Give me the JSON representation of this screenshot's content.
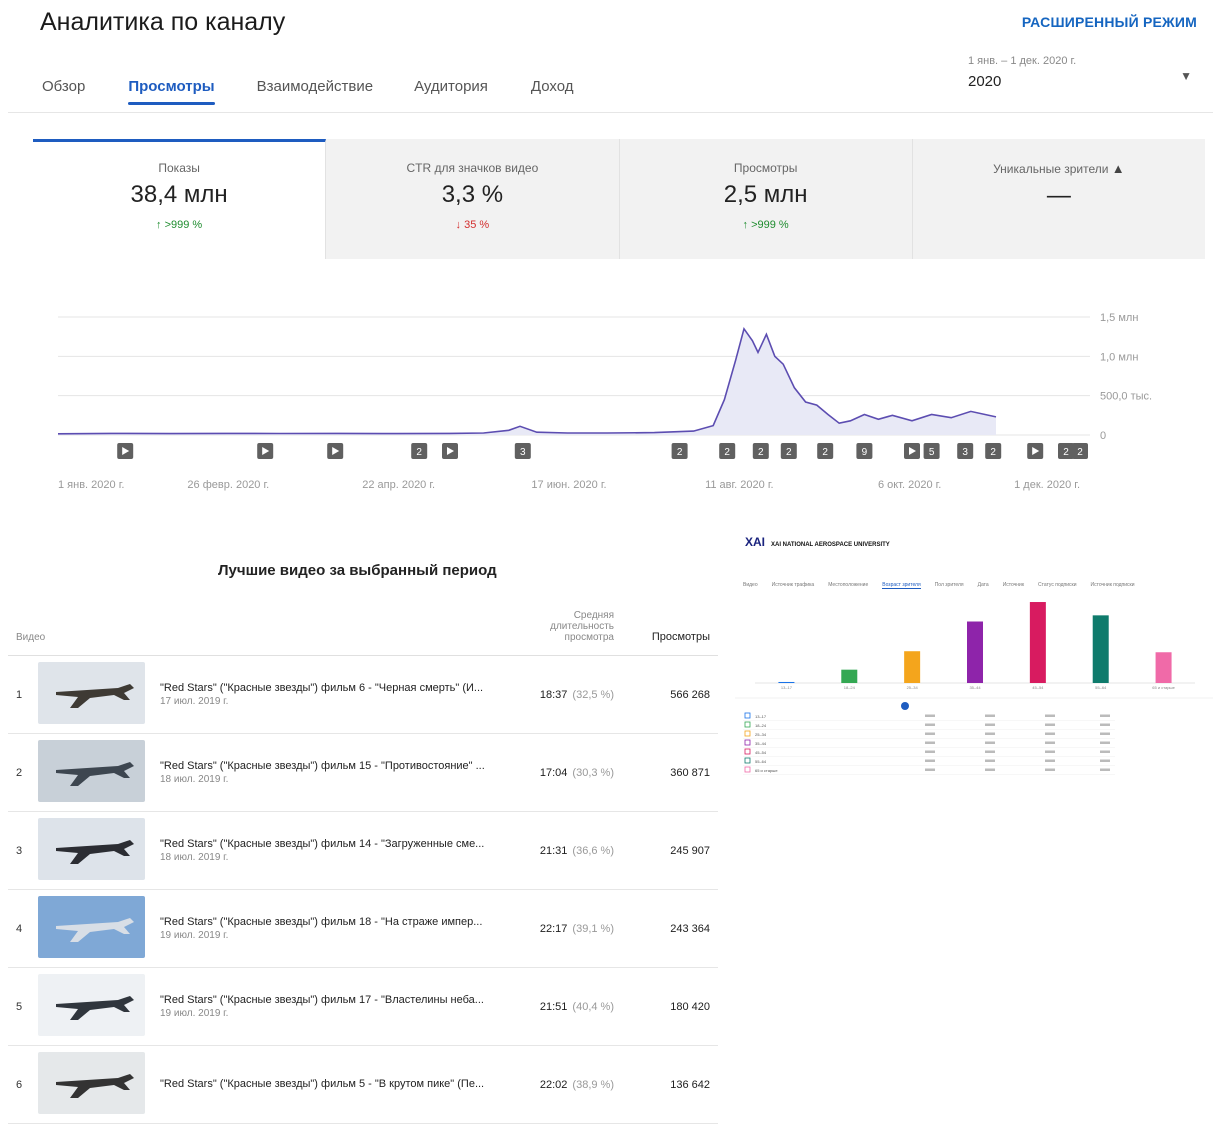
{
  "header": {
    "title": "Аналитика по каналу",
    "advanced_mode": "РАСШИРЕННЫЙ РЕЖИМ"
  },
  "tabs": [
    {
      "label": "Обзор",
      "active": false
    },
    {
      "label": "Просмотры",
      "active": true
    },
    {
      "label": "Взаимодействие",
      "active": false
    },
    {
      "label": "Аудитория",
      "active": false
    },
    {
      "label": "Доход",
      "active": false
    }
  ],
  "period": {
    "range": "1 янв. – 1 дек. 2020 г.",
    "year": "2020"
  },
  "metrics": [
    {
      "label": "Показы",
      "value": "38,4 млн",
      "change": ">999 %",
      "direction": "up",
      "arrow": "↑"
    },
    {
      "label": "CTR для значков видео",
      "value": "3,3 %",
      "change": "35 %",
      "direction": "down",
      "arrow": "↓"
    },
    {
      "label": "Просмотры",
      "value": "2,5 млн",
      "change": ">999 %",
      "direction": "up",
      "arrow": "↑"
    },
    {
      "label": "Уникальные зрители",
      "value": "—",
      "change": "",
      "direction": "none",
      "warning_icon": "warning-icon"
    }
  ],
  "chart_data": {
    "type": "area",
    "x_ticks": [
      "1 янв. 2020 г.",
      "26 февр. 2020 г.",
      "22 апр. 2020 г.",
      "17 июн. 2020 г.",
      "11 авг. 2020 г.",
      "6 окт. 2020 г.",
      "1 дек. 2020 г."
    ],
    "y_ticks": [
      "1,5 млн",
      "1,0 млн",
      "500,0 тыс.",
      "0"
    ],
    "ylim": [
      0,
      1500000
    ],
    "color": "#5c4db1",
    "x": [
      "2020-01-01",
      "2020-01-20",
      "2020-02-10",
      "2020-03-01",
      "2020-03-20",
      "2020-04-10",
      "2020-05-01",
      "2020-05-20",
      "2020-06-01",
      "2020-06-10",
      "2020-06-14",
      "2020-06-20",
      "2020-07-01",
      "2020-07-15",
      "2020-08-01",
      "2020-08-15",
      "2020-08-22",
      "2020-08-26",
      "2020-08-30",
      "2020-09-02",
      "2020-09-05",
      "2020-09-07",
      "2020-09-10",
      "2020-09-13",
      "2020-09-16",
      "2020-09-20",
      "2020-09-24",
      "2020-09-28",
      "2020-10-02",
      "2020-10-06",
      "2020-10-10",
      "2020-10-15",
      "2020-10-20",
      "2020-10-25",
      "2020-11-01",
      "2020-11-08",
      "2020-11-15",
      "2020-11-22",
      "2020-12-01"
    ],
    "values": [
      15000,
      20000,
      18000,
      20000,
      19000,
      20000,
      18000,
      20000,
      25000,
      60000,
      110000,
      35000,
      25000,
      25000,
      30000,
      50000,
      120000,
      450000,
      950000,
      1350000,
      1200000,
      1050000,
      1280000,
      1000000,
      900000,
      600000,
      420000,
      380000,
      260000,
      150000,
      180000,
      260000,
      200000,
      250000,
      180000,
      260000,
      220000,
      300000,
      230000
    ],
    "markers": [
      {
        "date": "2020-01-25",
        "label": ""
      },
      {
        "date": "2020-03-15",
        "label": ""
      },
      {
        "date": "2020-04-09",
        "label": ""
      },
      {
        "date": "2020-05-09",
        "label": "2"
      },
      {
        "date": "2020-05-20",
        "label": ""
      },
      {
        "date": "2020-06-15",
        "label": "3"
      },
      {
        "date": "2020-08-10",
        "label": "2"
      },
      {
        "date": "2020-08-27",
        "label": "2"
      },
      {
        "date": "2020-09-08",
        "label": "2"
      },
      {
        "date": "2020-09-18",
        "label": "2"
      },
      {
        "date": "2020-10-01",
        "label": "2"
      },
      {
        "date": "2020-10-15",
        "label": "9"
      },
      {
        "date": "2020-11-01",
        "label": ""
      },
      {
        "date": "2020-11-08",
        "label": "5"
      },
      {
        "date": "2020-11-20",
        "label": "3"
      },
      {
        "date": "2020-11-30",
        "label": "2"
      },
      {
        "date": "2020-12-15",
        "label": ""
      },
      {
        "date": "2020-12-26",
        "label": "2"
      },
      {
        "date": "2020-12-31",
        "label": "2"
      }
    ],
    "grid": true
  },
  "top_videos": {
    "title": "Лучшие видео за выбранный период",
    "col_video": "Видео",
    "col_avg": "Средняя длительность просмотра",
    "col_views": "Просмотры",
    "rows": [
      {
        "n": "1",
        "title": "\"Red Stars\" (\"Красные звезды\") фильм 6 - \"Черная смерть\" (И...",
        "date": "17 июл. 2019 г.",
        "dur": "18:37",
        "pct": "(32,5 %)",
        "views": "566 268",
        "sky": "#dfe4ea",
        "plane": "#3e3a34"
      },
      {
        "n": "2",
        "title": "\"Red Stars\" (\"Красные звезды\") фильм 15 - \"Противостояние\" ...",
        "date": "18 июл. 2019 г.",
        "dur": "17:04",
        "pct": "(30,3 %)",
        "views": "360 871",
        "sky": "#c8d0d8",
        "plane": "#3d4650"
      },
      {
        "n": "3",
        "title": "\"Red Stars\" (\"Красные звезды\") фильм 14 - \"Загруженные сме...",
        "date": "18 июл. 2019 г.",
        "dur": "21:31",
        "pct": "(36,6 %)",
        "views": "245 907",
        "sky": "#dde3ea",
        "plane": "#2b2d33"
      },
      {
        "n": "4",
        "title": "\"Red Stars\" (\"Красные звезды\") фильм 18 - \"На страже импер...",
        "date": "19 июл. 2019 г.",
        "dur": "22:17",
        "pct": "(39,1 %)",
        "views": "243 364",
        "sky": "#7fa8d6",
        "plane": "#d8dee6"
      },
      {
        "n": "5",
        "title": "\"Red Stars\" (\"Красные звезды\") фильм 17 - \"Властелины неба...",
        "date": "19 июл. 2019 г.",
        "dur": "21:51",
        "pct": "(40,4 %)",
        "views": "180 420",
        "sky": "#eef1f4",
        "plane": "#30363d"
      },
      {
        "n": "6",
        "title": "\"Red Stars\" (\"Красные звезды\") фильм 5 - \"В крутом пике\" (Пе...",
        "date": "",
        "dur": "22:02",
        "pct": "(38,9 %)",
        "views": "136 642",
        "sky": "#e5e8ea",
        "plane": "#333"
      }
    ]
  },
  "inset": {
    "logo": "ХАІ",
    "channel": "XAI NATIONAL AEROSPACE UNIVERSITY",
    "tabs": [
      "Видео",
      "Источник трафика",
      "Местоположение",
      "Возраст зрителя",
      "Пол зрителя",
      "Дата",
      "Источник",
      "Статус подписки",
      "Источник подписки"
    ],
    "active_tab": "Возраст зрителя",
    "bars": [
      {
        "label": "13–17",
        "value": 1,
        "color": "#1a73e8"
      },
      {
        "label": "18–24",
        "value": 13,
        "color": "#34a853"
      },
      {
        "label": "25–34",
        "value": 31,
        "color": "#f4a51c"
      },
      {
        "label": "35–44",
        "value": 60,
        "color": "#8e24aa"
      },
      {
        "label": "45–54",
        "value": 79,
        "color": "#d81b60"
      },
      {
        "label": "55–64",
        "value": 66,
        "color": "#0f7b6c"
      },
      {
        "label": "65 и старше",
        "value": 30,
        "color": "#f06aa8"
      }
    ],
    "rows": [
      {
        "label": "13–17",
        "color": "#1a73e8"
      },
      {
        "label": "18–24",
        "color": "#34a853"
      },
      {
        "label": "25–34",
        "color": "#f4a51c"
      },
      {
        "label": "35–44",
        "color": "#8e24aa"
      },
      {
        "label": "45–54",
        "color": "#d81b60"
      },
      {
        "label": "55–64",
        "color": "#0f7b6c"
      },
      {
        "label": "65 и старше",
        "color": "#f06aa8"
      }
    ]
  }
}
